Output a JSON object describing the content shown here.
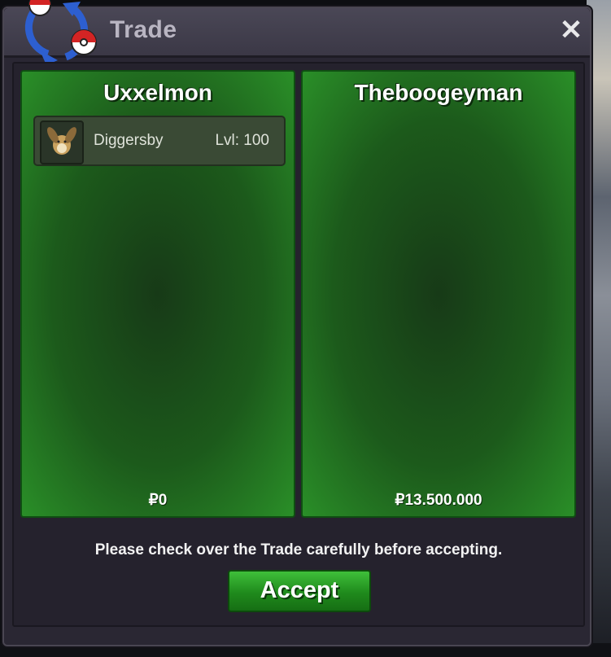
{
  "window": {
    "title": "Trade",
    "close_glyph": "✕"
  },
  "logo": {
    "icon": "trade-arrows-pokeball-icon"
  },
  "left_panel": {
    "player": "Uxxelmon",
    "pokemon": [
      {
        "name": "Diggersby",
        "level": "Lvl: 100",
        "icon": "diggersby-sprite-icon"
      }
    ],
    "money": "₽0"
  },
  "right_panel": {
    "player": "Theboogeyman",
    "pokemon": [],
    "money": "₽13.500.000"
  },
  "notice": "Please check over the Trade carefully before accepting.",
  "accept_label": "Accept",
  "colors": {
    "panel_green": "#1c5a1b",
    "button_green": "#2a9a26",
    "window": "#2a2733"
  }
}
